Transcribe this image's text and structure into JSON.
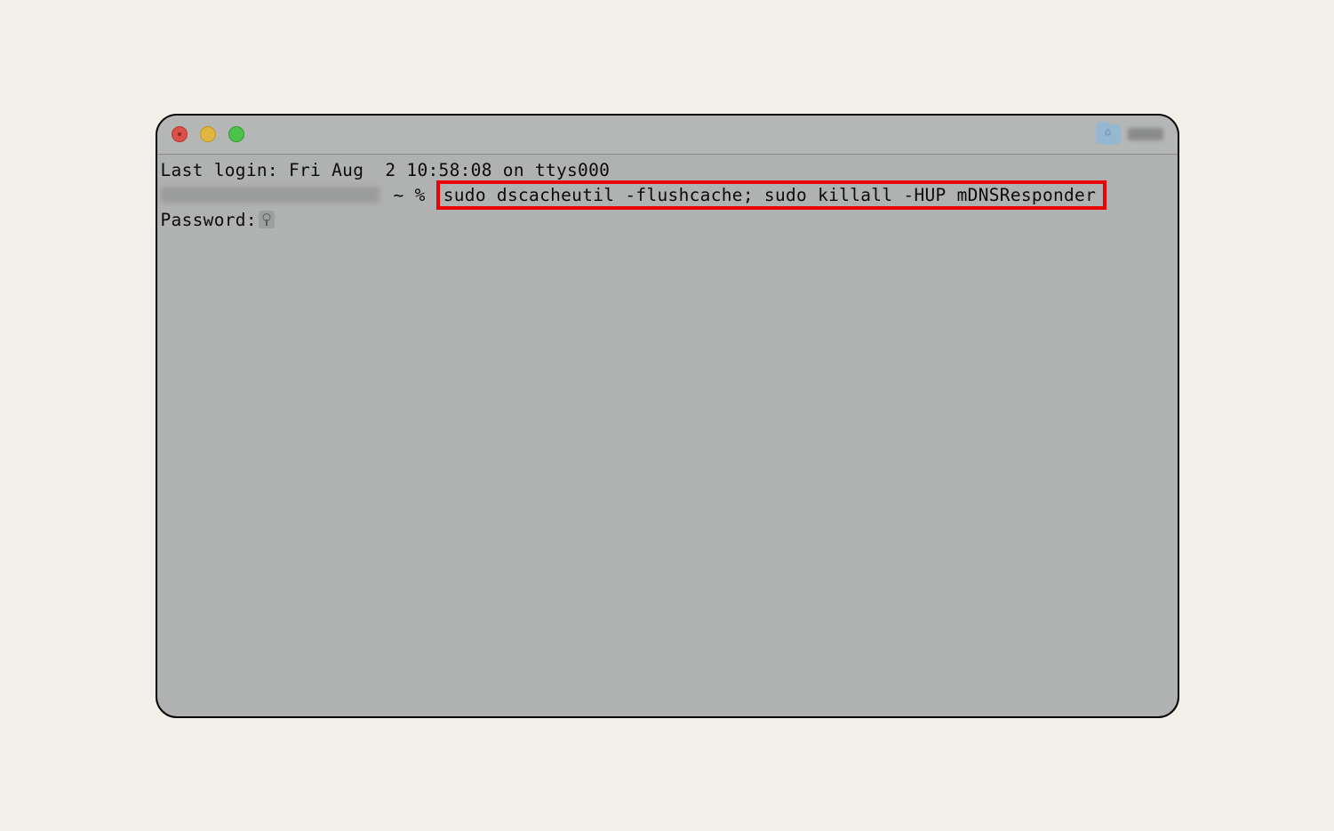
{
  "terminal": {
    "last_login": "Last login: Fri Aug  2 10:58:08 on ttys000",
    "prompt_symbol": " ~ % ",
    "command": "sudo dscacheutil -flushcache; sudo killall -HUP mDNSResponder",
    "password_prompt": "Password:"
  }
}
